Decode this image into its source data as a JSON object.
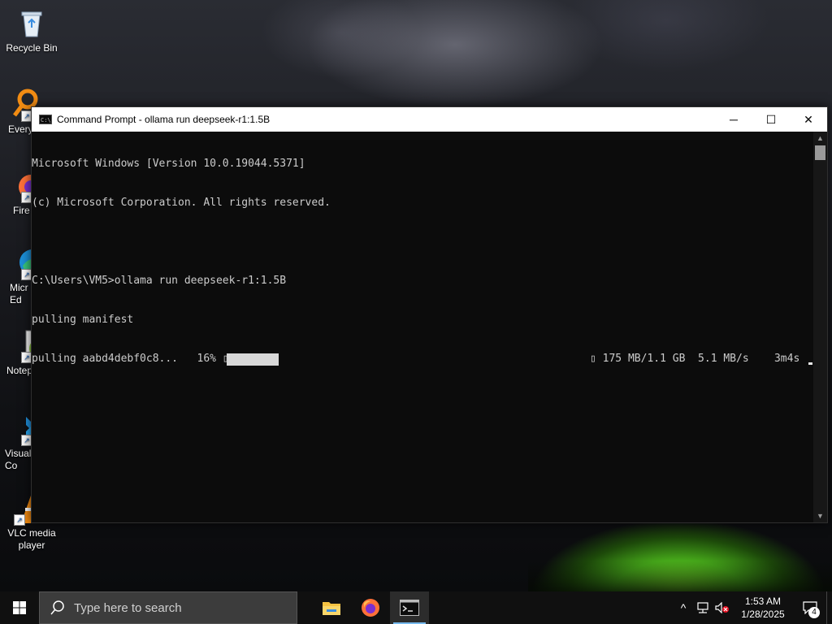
{
  "desktop": {
    "icons": [
      {
        "label": "Recycle Bin",
        "icon": "recycle-bin-icon"
      },
      {
        "label": "Every",
        "icon": "everything-search-icon"
      },
      {
        "label": "Fire",
        "icon": "firefox-icon"
      },
      {
        "label": "Micr\nEd",
        "icon": "microsoft-edge-icon"
      },
      {
        "label": "Notep",
        "icon": "notepad-plus-plus-icon"
      },
      {
        "label": "Visual\nCo",
        "icon": "visual-studio-code-icon"
      },
      {
        "label": "VLC media\nplayer",
        "icon": "vlc-icon"
      }
    ]
  },
  "window": {
    "title": "Command Prompt - ollama  run deepseek-r1:1.5B",
    "controls": {
      "minimize": "─",
      "maximize": "☐",
      "close": "✕"
    }
  },
  "console": {
    "lines": [
      "Microsoft Windows [Version 10.0.19044.5371]",
      "(c) Microsoft Corporation. All rights reserved.",
      "",
      "C:\\Users\\VM5>ollama run deepseek-r1:1.5B",
      "pulling manifest"
    ],
    "progress": {
      "prefix": "pulling aabd4debf0c8...   16% ▯",
      "percent": 16,
      "stats": "▯ 175 MB/1.1 GB  5.1 MB/s    3m4s"
    }
  },
  "taskbar": {
    "search_placeholder": "Type here to search",
    "apps": [
      {
        "name": "File Explorer",
        "icon": "file-explorer-icon"
      },
      {
        "name": "Firefox",
        "icon": "firefox-icon"
      },
      {
        "name": "Command Prompt",
        "icon": "command-prompt-icon",
        "active": true
      }
    ],
    "tray": {
      "chevron": "^",
      "time": "1:53 AM",
      "date": "1/28/2025",
      "notification_count": "4"
    }
  },
  "colors": {
    "console_bg": "#0c0c0c",
    "console_text": "#cccccc",
    "taskbar_bg": "#101010",
    "accent": "#76b9ed"
  }
}
